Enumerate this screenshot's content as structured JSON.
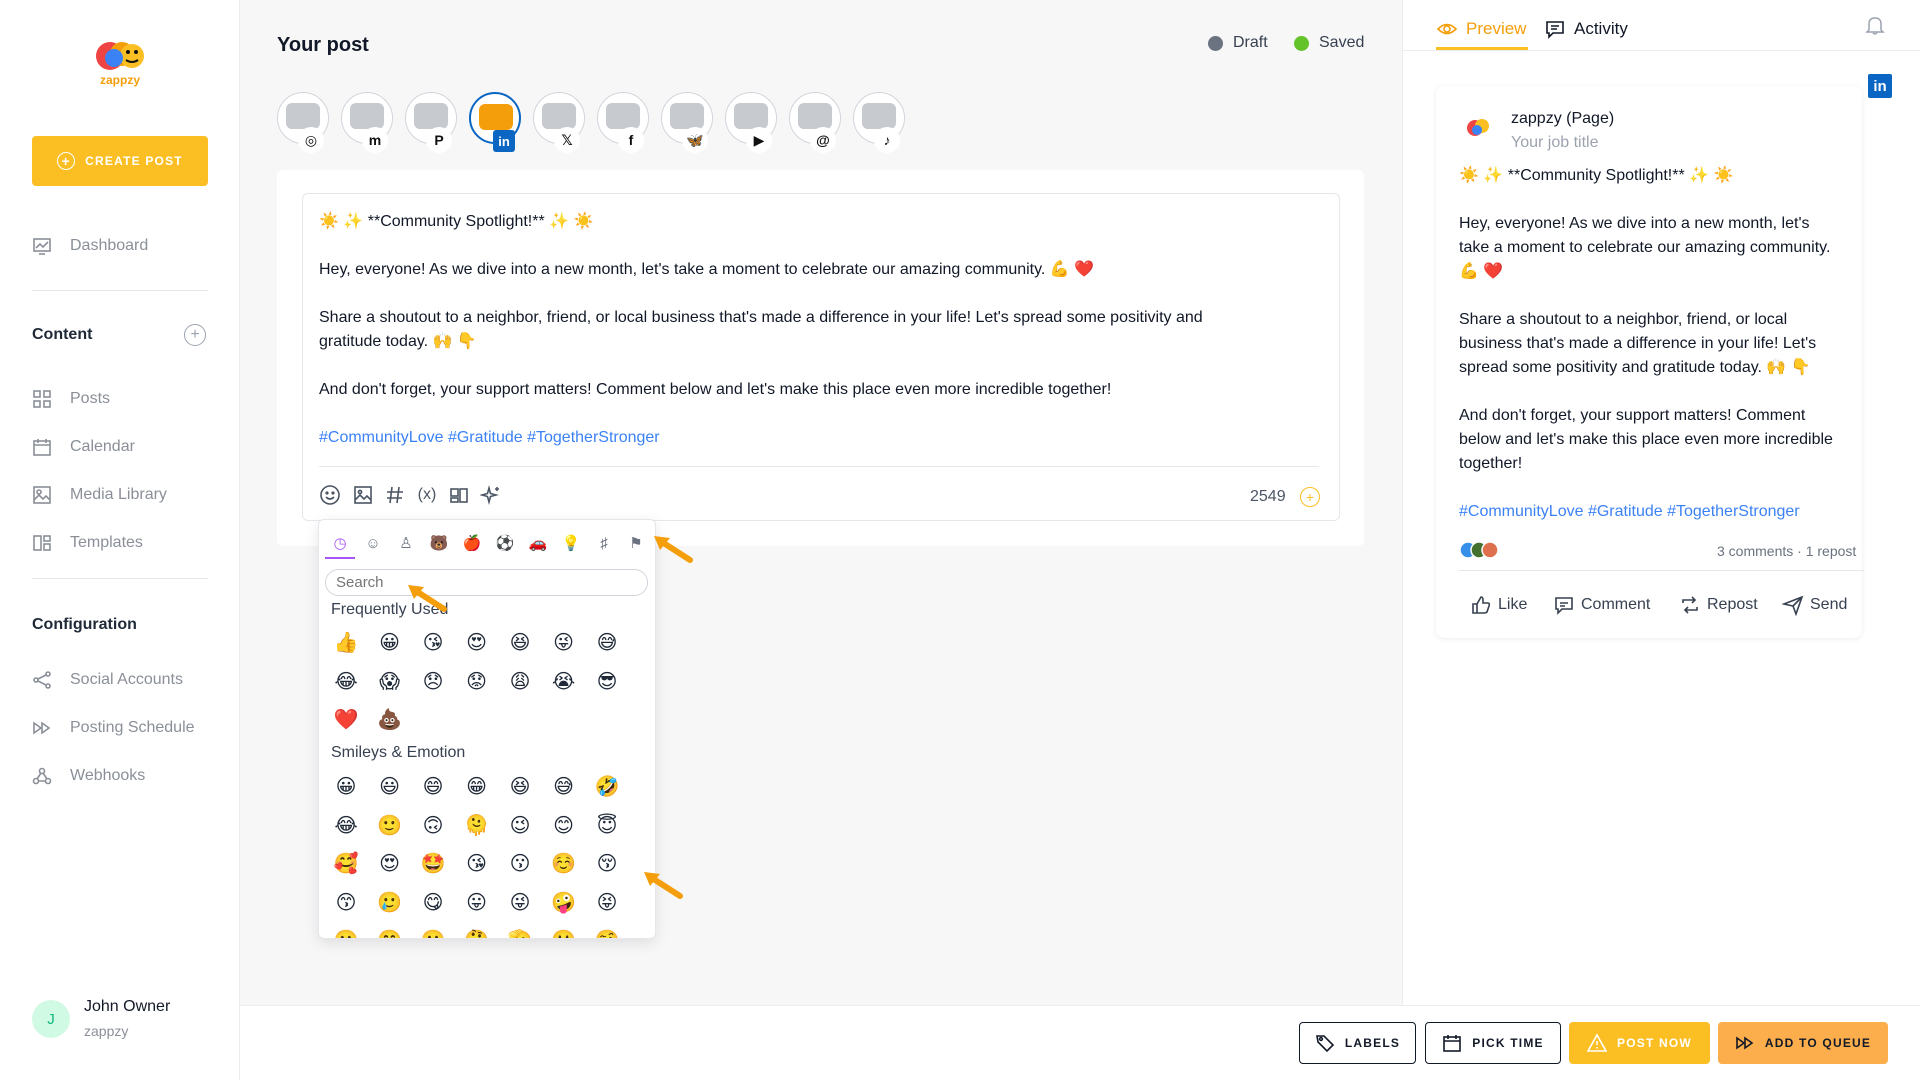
{
  "sidebar": {
    "brand": "zappzy",
    "create_label": "CREATE POST",
    "items_top": [
      {
        "label": "Dashboard",
        "icon": "dashboard-icon"
      }
    ],
    "content_title": "Content",
    "content_items": [
      {
        "label": "Posts",
        "icon": "grid-icon"
      },
      {
        "label": "Calendar",
        "icon": "calendar-icon"
      },
      {
        "label": "Media Library",
        "icon": "image-icon"
      },
      {
        "label": "Templates",
        "icon": "templates-icon"
      }
    ],
    "config_title": "Configuration",
    "config_items": [
      {
        "label": "Social Accounts",
        "icon": "share-icon"
      },
      {
        "label": "Posting Schedule",
        "icon": "schedule-icon"
      },
      {
        "label": "Webhooks",
        "icon": "webhook-icon"
      }
    ],
    "user": {
      "initial": "J",
      "name": "John Owner",
      "org": "zappzy"
    }
  },
  "editor": {
    "title": "Your post",
    "status_draft": "Draft",
    "status_saved": "Saved",
    "draft_color": "#6b7280",
    "saved_color": "#65c32a",
    "accounts": [
      "instagram",
      "mastodon",
      "pinterest",
      "linkedin",
      "x",
      "facebook",
      "bluesky",
      "youtube",
      "threads",
      "tiktok"
    ],
    "active_account": "linkedin",
    "lines": [
      "☀️ ✨ **Community Spotlight!** ✨ ☀️",
      "Hey, everyone! As we dive into a new month, let's take a moment to celebrate our amazing community. 💪 ❤️",
      "Share a shoutout to a neighbor, friend, or local business that's made a difference in your life! Let's spread some positivity and",
      "gratitude today. 🙌 👇",
      "And don't forget, your support matters! Comment below and let's make this place even more incredible together!",
      "#CommunityLove #Gratitude #TogetherStronger"
    ],
    "char_count": "2549"
  },
  "emoji_picker": {
    "search_placeholder": "Search",
    "group_frequent": "Frequently Used",
    "group_smileys": "Smileys & Emotion",
    "frequent": [
      "👍",
      "😀",
      "😘",
      "😍",
      "😆",
      "😜",
      "😅",
      "😂",
      "😱",
      "😞",
      "😟",
      "😩",
      "😭",
      "😎",
      "❤️",
      "💩"
    ],
    "smileys": [
      "😀",
      "😃",
      "😄",
      "😁",
      "😆",
      "😅",
      "🤣",
      "😂",
      "🙂",
      "🙃",
      "🫠",
      "😉",
      "😊",
      "😇",
      "🥰",
      "😍",
      "🤩",
      "😘",
      "😗",
      "☺️",
      "😚",
      "😙",
      "🥲",
      "😋",
      "😛",
      "😜",
      "🤪",
      "😝",
      "🫢",
      "🤭",
      "🤫",
      "🤔",
      "🫡",
      "🤐",
      "🤨"
    ]
  },
  "preview": {
    "tab_preview": "Preview",
    "tab_activity": "Activity",
    "page_name": "zappzy (Page)",
    "job_title": "Your job title",
    "lines": [
      "☀️ ✨ **Community Spotlight!** ✨ ☀️",
      "Hey, everyone! As we dive into a new month, let's",
      "take a moment to celebrate our amazing community.",
      "💪 ❤️",
      "Share a shoutout to a neighbor, friend, or local",
      "business that's made a difference in your life! Let's",
      "spread some positivity and gratitude today. 🙌 👇",
      "And don't forget, your support matters! Comment",
      "below and let's make this place even more incredible",
      "together!",
      "#CommunityLove #Gratitude #TogetherStronger"
    ],
    "stats": "3 comments · 1 repost",
    "actions": [
      "Like",
      "Comment",
      "Repost",
      "Send"
    ]
  },
  "bottom": {
    "labels": "LABELS",
    "pick_time": "PICK TIME",
    "post_now": "POST NOW",
    "add_to_queue": "ADD TO QUEUE"
  }
}
